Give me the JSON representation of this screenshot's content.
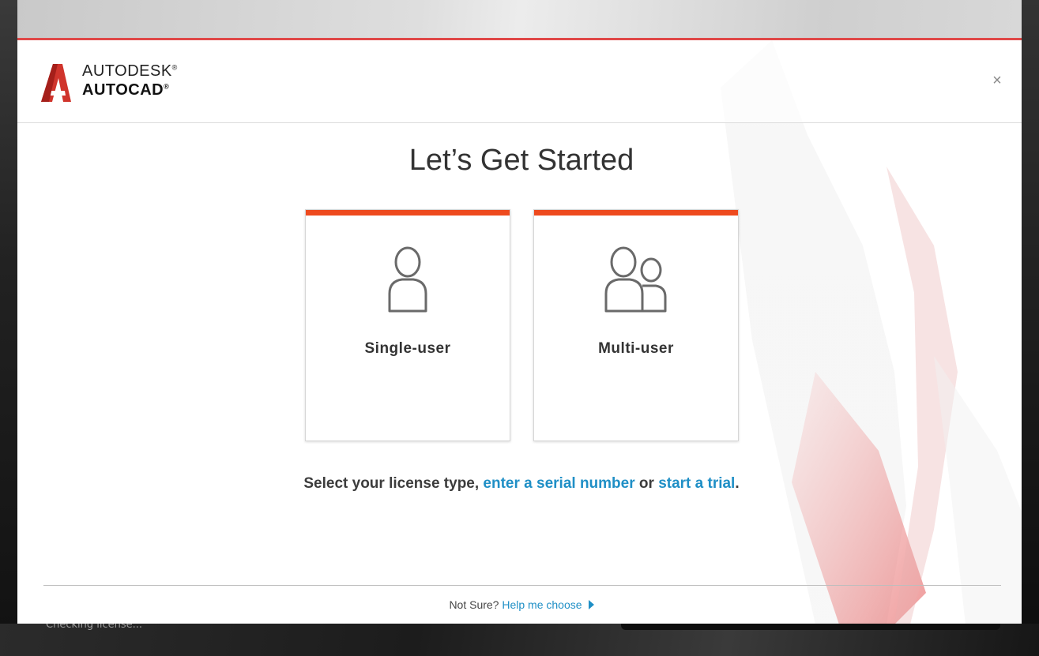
{
  "app": {
    "brand_line1": "AUTODESK",
    "brand_line2": "AUTOCAD",
    "registered_mark": "®"
  },
  "dialog": {
    "title": "Let’s Get Started",
    "close_glyph": "×",
    "cards": [
      {
        "label": "Single-user",
        "icon": "single-user-icon"
      },
      {
        "label": "Multi-user",
        "icon": "multi-user-icon"
      }
    ],
    "instruction": {
      "prefix": "Select your license type, ",
      "serial_link": "enter a serial number",
      "middle": " or ",
      "trial_link": "start a trial",
      "suffix": "."
    },
    "footer": {
      "prefix": "Not Sure? ",
      "help_link": "Help me choose"
    }
  },
  "background": {
    "status_text": "Checking license..."
  },
  "colors": {
    "accent_red": "#e04848",
    "card_bar": "#ee4a1e",
    "link_blue": "#1f8fc6",
    "logo_red": "#d0342c"
  }
}
